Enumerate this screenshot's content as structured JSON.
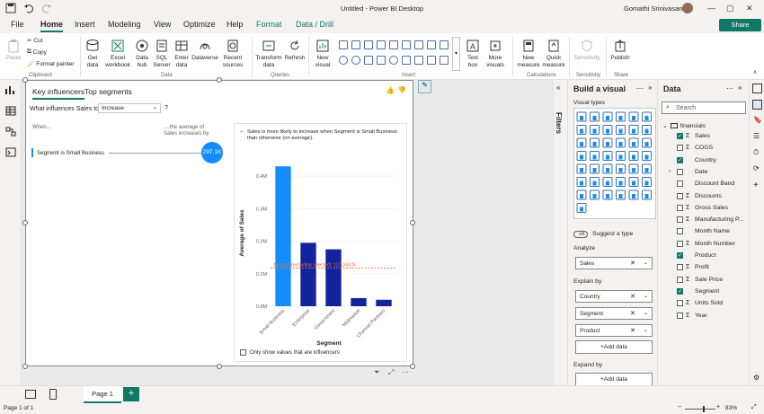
{
  "titlebar": {
    "title": "Untitled - Power BI Desktop",
    "user": "Gomathi Srinivasan"
  },
  "menu": {
    "file": "File",
    "home": "Home",
    "insert": "Insert",
    "modeling": "Modeling",
    "view": "View",
    "optimize": "Optimize",
    "help": "Help",
    "format": "Format",
    "datadrill": "Data / Drill",
    "share": "Share"
  },
  "ribbon": {
    "paste": "Paste",
    "cut": "Cut",
    "copy": "Copy",
    "format_painter": "Format painter",
    "get_data": "Get data",
    "excel": "Excel workbook",
    "data_hub": "Data hub",
    "sql": "SQL Server",
    "enter_data": "Enter data",
    "dataverse": "Dataverse",
    "recent": "Recent sources",
    "transform": "Transform data",
    "refresh": "Refresh",
    "new_visual": "New visual",
    "text_box": "Text box",
    "more_visuals": "More visuals",
    "new_measure": "New measure",
    "quick_measure": "Quick measure",
    "sensitivity": "Sensitivity",
    "publish": "Publish",
    "groups": {
      "clipboard": "Clipboard",
      "data": "Data",
      "queries": "Queries",
      "insert": "Insert",
      "calculations": "Calculations",
      "sensitivity": "Sensitivity",
      "share": "Share"
    }
  },
  "visual": {
    "tab_key": "Key influencers",
    "tab_top": "Top segments",
    "question": "What influences Sales to",
    "dropdown": "Increase",
    "help": "?",
    "when": "When...",
    "avg_label": "....the average of Sales increases by",
    "influencer": "Segment is Small Business",
    "bubble": "297.1K",
    "detail_title": "Sales is more likely to increase when Segment is Small Business than otherwise (on average).",
    "average_line": "Average (excluding selected): 117,164.05",
    "checkbox_label": "Only show values that are influencers"
  },
  "chart_data": {
    "type": "bar",
    "categories": [
      "Small Business",
      "Enterprise",
      "Government",
      "Midmarket",
      "Channel Partners"
    ],
    "values": [
      0.43,
      0.195,
      0.175,
      0.025,
      0.02
    ],
    "highlight": "Small Business",
    "reference_line": 0.1172,
    "xlabel": "Segment",
    "ylabel": "Average of Sales",
    "yticks": [
      "0.0M",
      "0.1M",
      "0.2M",
      "0.3M",
      "0.4M"
    ],
    "ylim": [
      0,
      0.45
    ],
    "colors": {
      "highlight": "#118dff",
      "base": "#12239e",
      "reference": "#e66c37"
    }
  },
  "filters_label": "Filters",
  "build": {
    "title": "Build a visual",
    "visual_types": "Visual types",
    "suggest": "Suggest a type",
    "toggle": "Off",
    "analyze": "Analyze",
    "analyze_field": "Sales",
    "explain_by": "Explain by",
    "explain": [
      "Country",
      "Segment",
      "Product"
    ],
    "add_data": "+Add data",
    "expand_by": "Expand by"
  },
  "data": {
    "title": "Data",
    "search": "Search",
    "table": "financials",
    "fields": [
      {
        "name": "Sales",
        "sigma": true,
        "checked": true
      },
      {
        "name": "COGS",
        "sigma": true,
        "checked": false
      },
      {
        "name": "Country",
        "sigma": false,
        "checked": true
      },
      {
        "name": "Date",
        "sigma": false,
        "checked": false,
        "expand": true
      },
      {
        "name": "Discount Band",
        "sigma": false,
        "checked": false
      },
      {
        "name": "Discounts",
        "sigma": true,
        "checked": false
      },
      {
        "name": "Gross Sales",
        "sigma": true,
        "checked": false
      },
      {
        "name": "Manufacturing P...",
        "sigma": true,
        "checked": false
      },
      {
        "name": "Month Name",
        "sigma": false,
        "checked": false
      },
      {
        "name": "Month Number",
        "sigma": true,
        "checked": false
      },
      {
        "name": "Product",
        "sigma": false,
        "checked": true
      },
      {
        "name": "Profit",
        "sigma": true,
        "checked": false
      },
      {
        "name": "Sale Price",
        "sigma": true,
        "checked": false
      },
      {
        "name": "Segment",
        "sigma": false,
        "checked": true
      },
      {
        "name": "Units Sold",
        "sigma": true,
        "checked": false
      },
      {
        "name": "Year",
        "sigma": true,
        "checked": false
      }
    ]
  },
  "pages": {
    "page1": "Page 1",
    "add": "+"
  },
  "status": {
    "page_of": "Page 1 of 1",
    "zoom": "83%"
  }
}
